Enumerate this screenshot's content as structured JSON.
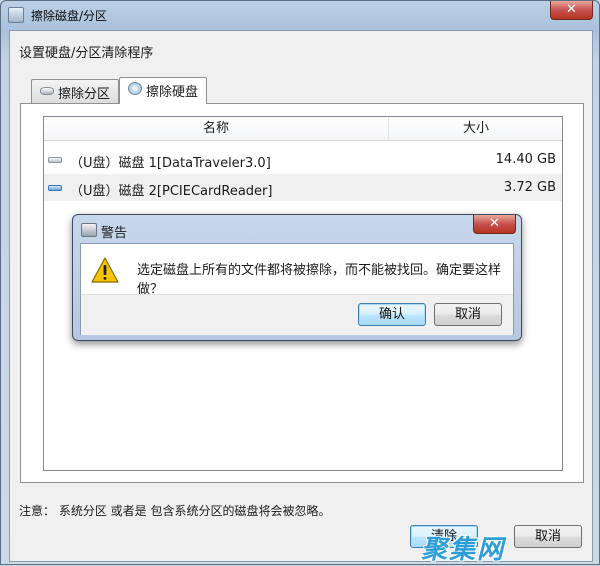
{
  "window": {
    "title": "擦除磁盘/分区",
    "close_glyph": "✕"
  },
  "main": {
    "subtitle": "设置硬盘/分区清除程序",
    "tabs": [
      {
        "label": "擦除分区",
        "icon": "partition-icon"
      },
      {
        "label": "擦除硬盘",
        "icon": "disk-icon"
      }
    ],
    "list": {
      "columns": [
        "名称",
        "大小"
      ],
      "rows": [
        {
          "name": "（U盘）磁盘 1[DataTraveler3.0]",
          "size": "14.40 GB"
        },
        {
          "name": "（U盘）磁盘 2[PCIECardReader]",
          "size": "3.72 GB"
        }
      ]
    },
    "note": "注意： 系统分区 或者是 包含系统分区的磁盘将会被忽略。",
    "footer_buttons": [
      "清除",
      "取消"
    ]
  },
  "dialog": {
    "title": "警告",
    "icon": "warning-icon",
    "message": "选定磁盘上所有的文件都将被擦除，而不能被找回。确定要这样做？",
    "confirm_label": "确认",
    "cancel_label": "取消",
    "close_glyph": "✕"
  },
  "watermark": "聚集网"
}
